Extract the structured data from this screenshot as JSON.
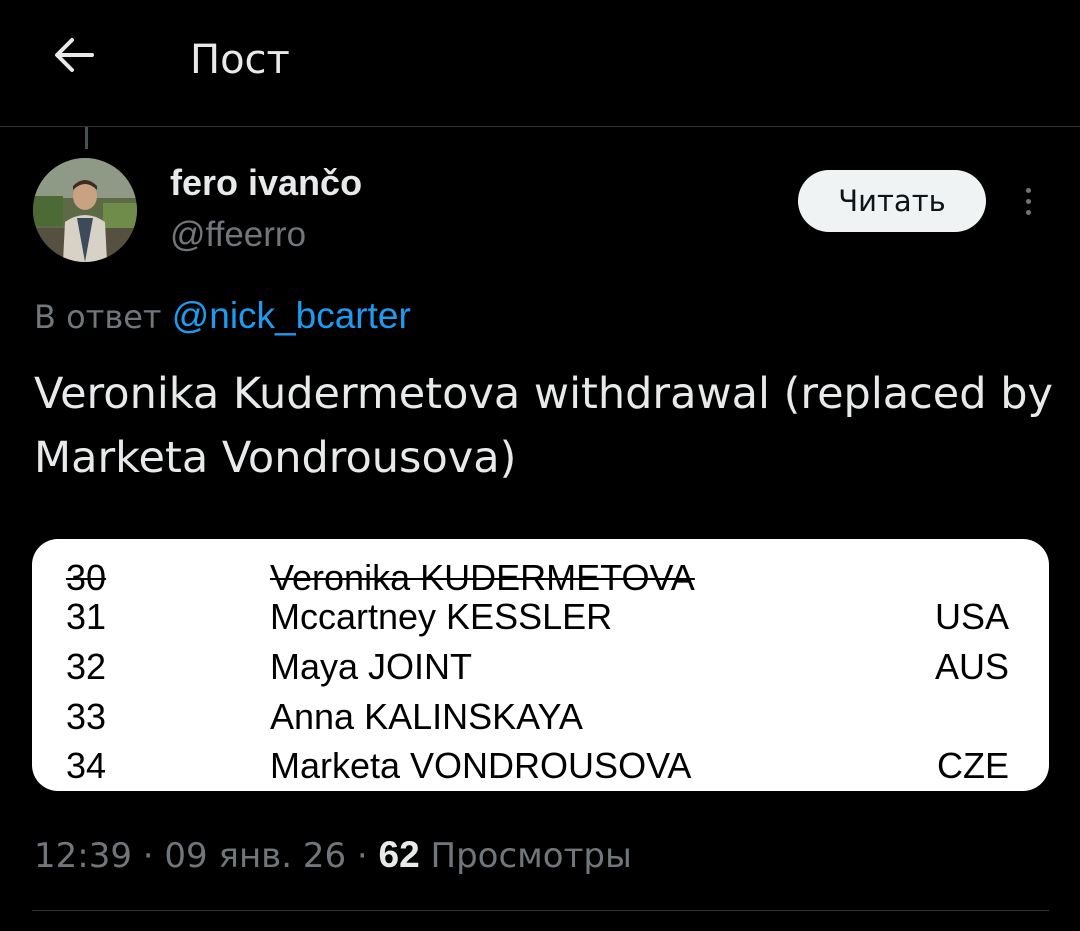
{
  "header": {
    "back_icon": "arrow-left-icon",
    "title": "Пост"
  },
  "author": {
    "name": "fero ivančo",
    "handle": "@ffeerro",
    "follow_label": "Читать",
    "more_icon": "more-vertical-icon"
  },
  "reply": {
    "prefix": "В ответ",
    "mention": "@nick_bcarter"
  },
  "tweet": {
    "text": "Veronika Kudermetova withdrawal (replaced by Marketa Vondrousova)"
  },
  "media": {
    "entries": [
      {
        "num": "30",
        "name": "Veronika KUDERMETOVA",
        "country": "",
        "struck": true
      },
      {
        "num": "31",
        "name": "Mccartney KESSLER",
        "country": "USA",
        "struck": false
      },
      {
        "num": "32",
        "name": "Maya JOINT",
        "country": "AUS",
        "struck": false
      },
      {
        "num": "33",
        "name": "Anna KALINSKAYA",
        "country": "",
        "struck": false
      },
      {
        "num": "34",
        "name": "Marketa VONDROUSOVA",
        "country": "CZE",
        "struck": false
      }
    ]
  },
  "meta": {
    "time": "12:39",
    "date": "09 янв. 26",
    "separator": "·",
    "views_count": "62",
    "views_label": "Просмотры"
  },
  "colors": {
    "background": "#000000",
    "text_primary": "#e7e9ea",
    "text_secondary": "#71767b",
    "link": "#1d9bf0",
    "divider": "#2f3336",
    "follow_bg": "#eff3f4"
  }
}
